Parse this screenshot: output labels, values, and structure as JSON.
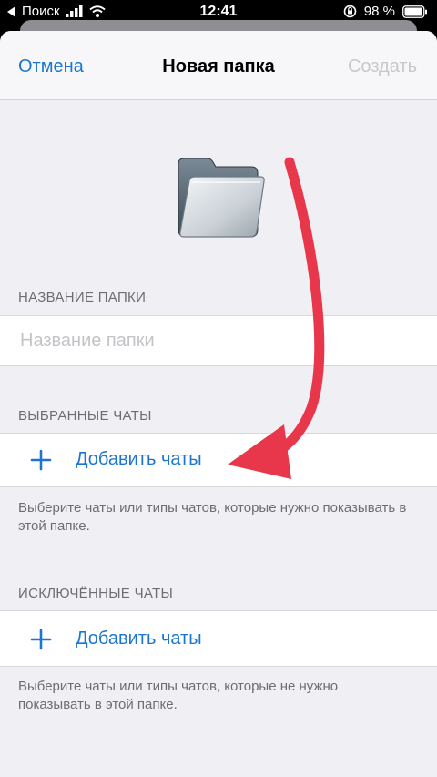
{
  "status_bar": {
    "back_app": "Поиск",
    "time": "12:41",
    "battery": "98 %"
  },
  "nav": {
    "cancel_label": "Отмена",
    "title": "Новая папка",
    "create_label": "Создать"
  },
  "folder_name_section": {
    "header": "НАЗВАНИЕ ПАПКИ",
    "placeholder": "Название папки",
    "value": ""
  },
  "included_section": {
    "header": "ВЫБРАННЫЕ ЧАТЫ",
    "add_label": "Добавить чаты",
    "hint": "Выберите чаты или типы чатов, которые нужно показывать в этой папке."
  },
  "excluded_section": {
    "header": "ИСКЛЮЧЁННЫЕ ЧАТЫ",
    "add_label": "Добавить чаты",
    "hint": "Выберите чаты или типы чатов, которые не нужно показывать в этой папке."
  },
  "colors": {
    "accent": "#1b76d2",
    "arrow": "#e8364a",
    "disabled": "#c7c7cc",
    "background": "#efeff4"
  },
  "icons": [
    "back-arrow-icon",
    "signal-icon",
    "wifi-icon",
    "orientation-lock-icon",
    "battery-icon",
    "folder-icon",
    "plus-icon"
  ]
}
